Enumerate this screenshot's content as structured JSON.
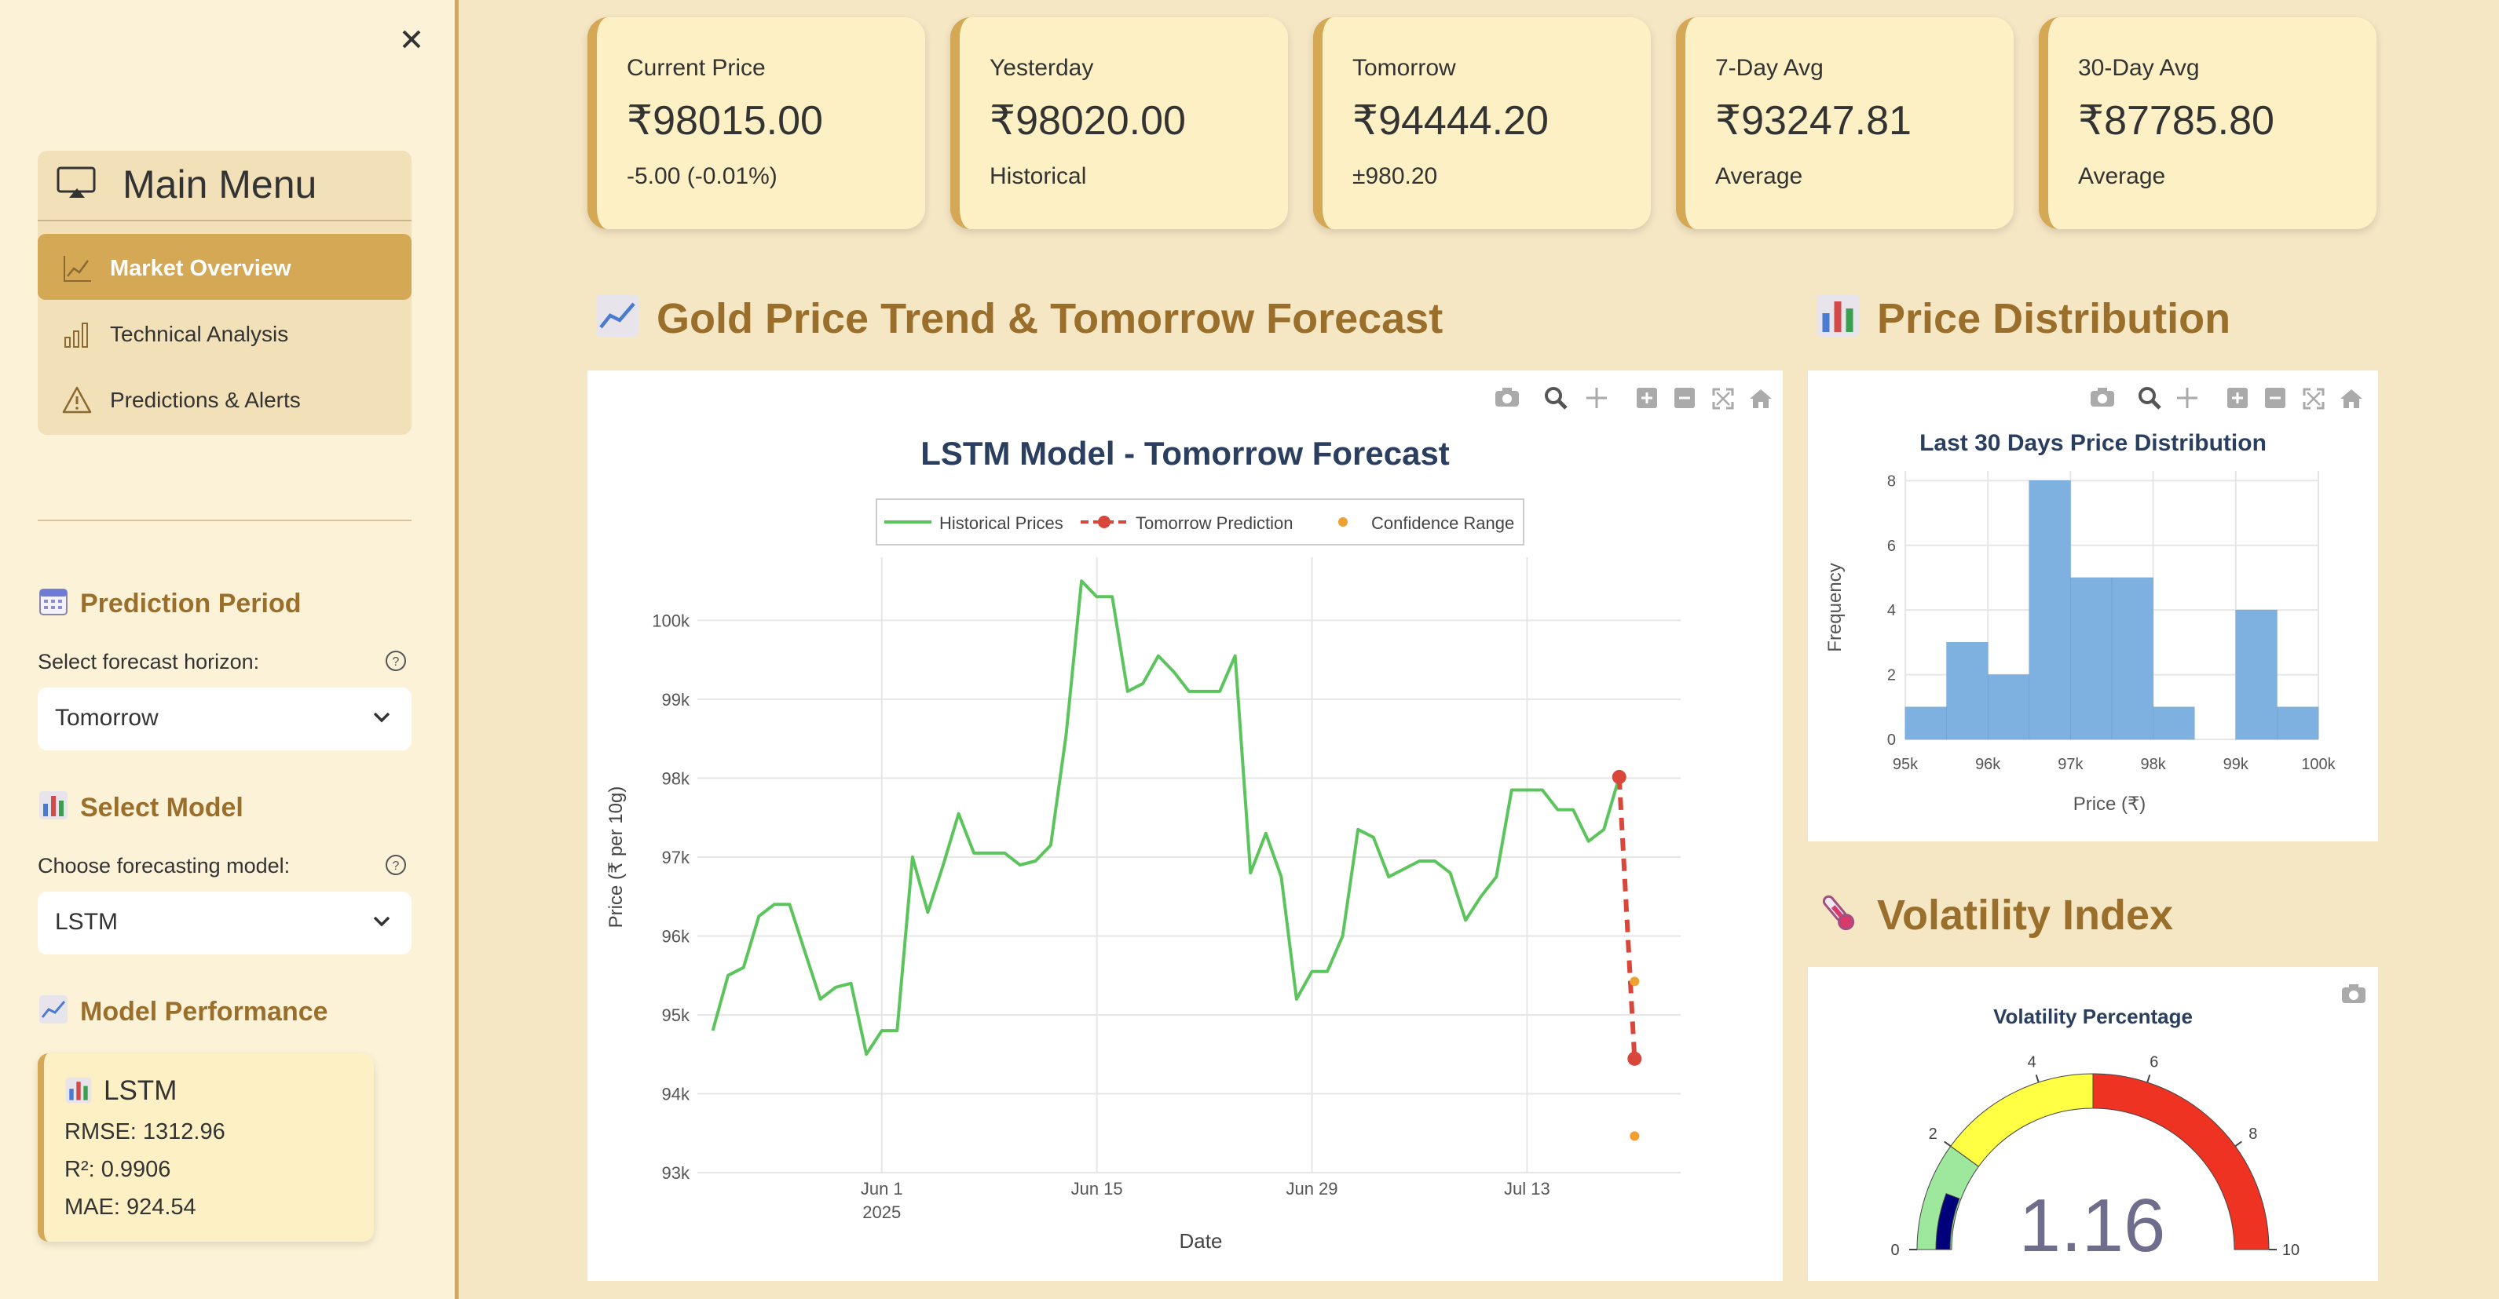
{
  "sidebar": {
    "menu_title": "Main Menu",
    "menu_items": [
      {
        "label": "Market Overview",
        "icon": "line-chart-icon",
        "active": true
      },
      {
        "label": "Technical Analysis",
        "icon": "bar-chart-icon",
        "active": false
      },
      {
        "label": "Predictions & Alerts",
        "icon": "warning-icon",
        "active": false
      }
    ],
    "prediction_period": {
      "heading": "Prediction Period",
      "label": "Select forecast horizon:",
      "value": "Tomorrow"
    },
    "select_model": {
      "heading": "Select Model",
      "label": "Choose forecasting model:",
      "value": "LSTM"
    },
    "model_performance": {
      "heading": "Model Performance",
      "card_title": "LSTM",
      "rmse": "RMSE: 1312.96",
      "r2": "R²: 0.9906",
      "mae": "MAE: 924.54"
    }
  },
  "kpis": [
    {
      "label": "Current Price",
      "value": "₹98015.00",
      "sub": "-5.00 (-0.01%)"
    },
    {
      "label": "Yesterday",
      "value": "₹98020.00",
      "sub": "Historical"
    },
    {
      "label": "Tomorrow",
      "value": "₹94444.20",
      "sub": "±980.20"
    },
    {
      "label": "7-Day Avg",
      "value": "₹93247.81",
      "sub": "Average"
    },
    {
      "label": "30-Day Avg",
      "value": "₹87785.80",
      "sub": "Average"
    }
  ],
  "sections": {
    "trend": "Gold Price Trend & Tomorrow Forecast",
    "distribution": "Price Distribution",
    "volatility": "Volatility Index"
  },
  "colors": {
    "accent": "#d4a855",
    "heading": "#9a6f2c",
    "historical": "#5cc45c",
    "prediction": "#d9473a",
    "confidence": "#f0a030",
    "histogram": "#7eb0e0",
    "gauge_low": "#9ee89e",
    "gauge_mid": "#ffff44",
    "gauge_high": "#ee3322",
    "gauge_bar": "#00007a"
  },
  "chart_data": [
    {
      "type": "line",
      "title": "LSTM Model - Tomorrow Forecast",
      "xlabel": "Date",
      "ylabel": "Price (₹ per 10g)",
      "legend": [
        "Historical Prices",
        "Tomorrow Prediction",
        "Confidence Range"
      ],
      "legend_position": "top-center",
      "x_ticks": [
        "Jun 1",
        "Jun 15",
        "Jun 29",
        "Jul 13"
      ],
      "x_tick_sub": "2025",
      "y_ticks": [
        "93k",
        "94k",
        "95k",
        "96k",
        "97k",
        "98k",
        "99k",
        "100k"
      ],
      "ylim": [
        93000,
        100800
      ],
      "xlim": [
        "2025-05-20",
        "2025-07-23"
      ],
      "series": [
        {
          "name": "Historical Prices",
          "x": [
            "2025-05-21",
            "2025-05-22",
            "2025-05-23",
            "2025-05-24",
            "2025-05-25",
            "2025-05-26",
            "2025-05-27",
            "2025-05-28",
            "2025-05-29",
            "2025-05-30",
            "2025-05-31",
            "2025-06-01",
            "2025-06-02",
            "2025-06-03",
            "2025-06-04",
            "2025-06-05",
            "2025-06-06",
            "2025-06-07",
            "2025-06-08",
            "2025-06-09",
            "2025-06-10",
            "2025-06-11",
            "2025-06-12",
            "2025-06-13",
            "2025-06-14",
            "2025-06-15",
            "2025-06-16",
            "2025-06-17",
            "2025-06-18",
            "2025-06-19",
            "2025-06-20",
            "2025-06-21",
            "2025-06-22",
            "2025-06-23",
            "2025-06-24",
            "2025-06-25",
            "2025-06-26",
            "2025-06-27",
            "2025-06-28",
            "2025-06-29",
            "2025-06-30",
            "2025-07-01",
            "2025-07-02",
            "2025-07-03",
            "2025-07-04",
            "2025-07-05",
            "2025-07-06",
            "2025-07-07",
            "2025-07-08",
            "2025-07-09",
            "2025-07-10",
            "2025-07-11",
            "2025-07-12",
            "2025-07-13",
            "2025-07-14",
            "2025-07-15",
            "2025-07-16",
            "2025-07-17",
            "2025-07-18",
            "2025-07-19"
          ],
          "values": [
            94800,
            95500,
            95600,
            96250,
            96400,
            96400,
            95800,
            95200,
            95350,
            95400,
            94500,
            94800,
            94800,
            97000,
            96300,
            96900,
            97550,
            97050,
            97050,
            97050,
            96900,
            96950,
            97150,
            98550,
            100500,
            100300,
            100300,
            99100,
            99200,
            99550,
            99350,
            99100,
            99100,
            99100,
            99550,
            96800,
            97300,
            96750,
            95200,
            95550,
            95550,
            96000,
            97350,
            97250,
            96750,
            96850,
            96950,
            96950,
            96800,
            96200,
            96500,
            96750,
            97850,
            97850,
            97850,
            97600,
            97600,
            97200,
            97350,
            98015
          ]
        },
        {
          "name": "Tomorrow Prediction",
          "x": [
            "2025-07-19",
            "2025-07-20"
          ],
          "values": [
            98015,
            94444.2
          ]
        },
        {
          "name": "Confidence Range",
          "x": [
            "2025-07-20",
            "2025-07-20"
          ],
          "values": [
            95424.4,
            93464.0
          ]
        }
      ]
    },
    {
      "type": "bar",
      "title": "Last 30 Days Price Distribution",
      "xlabel": "Price (₹)",
      "ylabel": "Frequency",
      "x_ticks": [
        "95k",
        "96k",
        "97k",
        "98k",
        "99k",
        "100k"
      ],
      "y_ticks": [
        "0",
        "2",
        "4",
        "6",
        "8"
      ],
      "bin_edges": [
        95000,
        95500,
        96000,
        96500,
        97000,
        97500,
        98000,
        98500,
        99000,
        99500,
        100000
      ],
      "values": [
        1,
        3,
        2,
        8,
        5,
        5,
        1,
        0,
        4,
        1
      ],
      "ylim": [
        0,
        8.3
      ]
    },
    {
      "type": "gauge",
      "title": "Volatility Percentage",
      "value": 1.16,
      "value_text": "1.16",
      "range": [
        0,
        10
      ],
      "ticks": [
        "0",
        "2",
        "4",
        "6",
        "8",
        "10"
      ],
      "steps": [
        {
          "from": 0,
          "to": 2
        },
        {
          "from": 2,
          "to": 5
        },
        {
          "from": 5,
          "to": 10
        }
      ]
    }
  ]
}
